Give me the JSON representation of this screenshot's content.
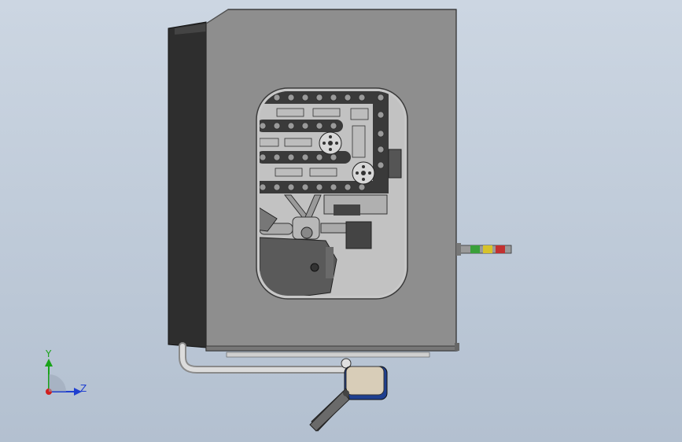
{
  "viewport": {
    "background_top": "#ccd6e2",
    "background_bottom": "#b3c0d0"
  },
  "model": {
    "housing_color": "#8f8f8f",
    "side_panel_color": "#2f2f2f",
    "window_frame_color": "#9a9a9a",
    "mechanism_color": "#c6c6c6",
    "stack_light_colors": [
      "#3aa03a",
      "#d7c22a",
      "#c23030"
    ],
    "foot_pedal_color": "#d8cdb8",
    "foot_pedal_base_color": "#1f3f8f"
  },
  "triad": {
    "y_label": "Y",
    "z_label": "Z",
    "y_color": "#1aa31a",
    "z_color": "#1f3fd0",
    "x_color": "#d01f1f"
  }
}
